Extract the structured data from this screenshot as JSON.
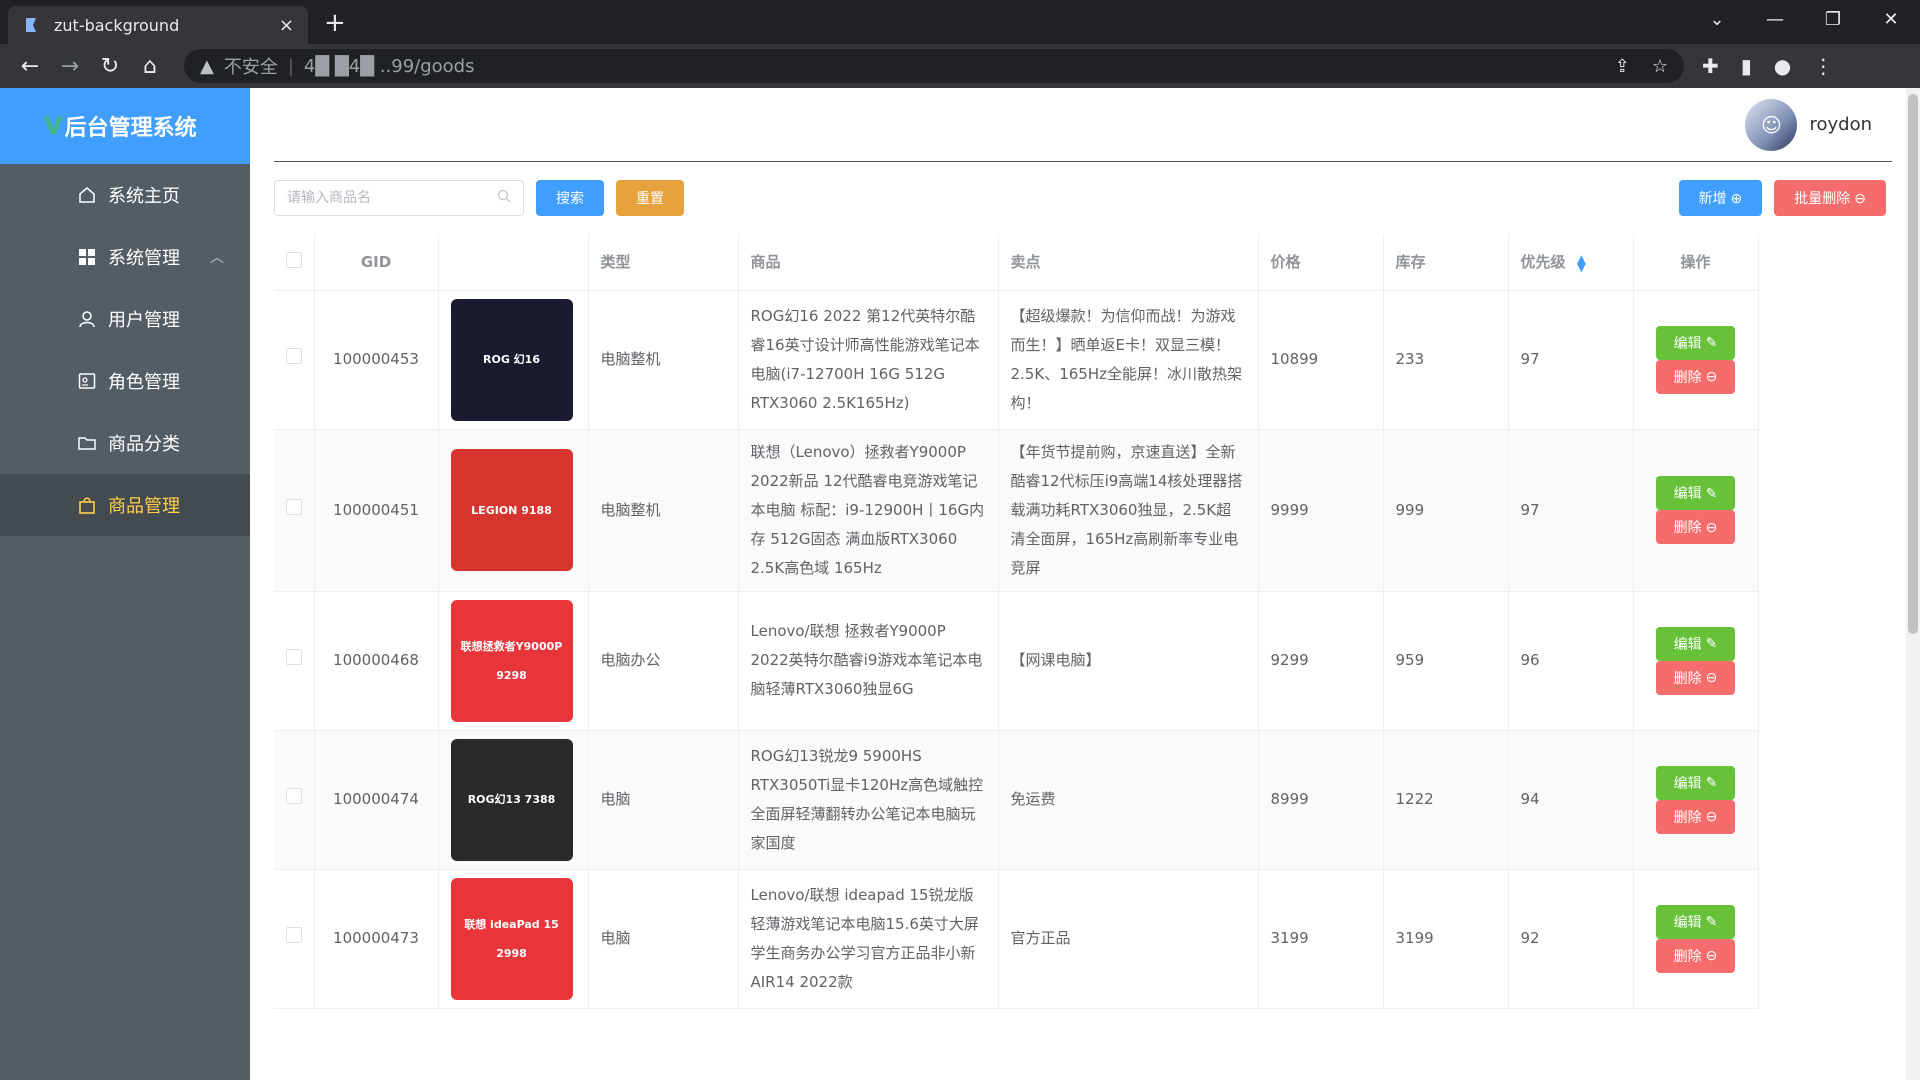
{
  "browser": {
    "tab_title": "zut-background",
    "tab_close": "×",
    "new_tab": "+",
    "security_label": "不安全",
    "url": "4█ █4█ ..99/goods"
  },
  "app": {
    "brand_logo": "V",
    "brand_title": "后台管理系统"
  },
  "sidebar": {
    "items": [
      {
        "label": "系统主页",
        "icon": "home-icon"
      },
      {
        "label": "系统管理",
        "icon": "grid-icon"
      },
      {
        "label": "用户管理",
        "icon": "user-icon"
      },
      {
        "label": "角色管理",
        "icon": "id-card-icon"
      },
      {
        "label": "商品分类",
        "icon": "folder-icon"
      },
      {
        "label": "商品管理",
        "icon": "shopping-bag-icon",
        "active": true
      }
    ]
  },
  "header": {
    "username": "roydon"
  },
  "controls": {
    "search_placeholder": "请输入商品名",
    "search_button": "搜索",
    "reset_button": "重置",
    "add_button": "新增",
    "batch_delete_button": "批量删除"
  },
  "table": {
    "columns": [
      "GID",
      "",
      "类型",
      "商品",
      "卖点",
      "价格",
      "库存",
      "优先级",
      "操作"
    ],
    "edit_label": "编辑",
    "delete_label": "删除",
    "rows": [
      {
        "gid": "100000453",
        "type": "电脑整机",
        "product": "ROG幻16 2022 第12代英特尔酷睿16英寸设计师高性能游戏笔记本电脑(i7-12700H 16G 512G RTX3060 2.5K165Hz)",
        "selling_point": "【超级爆款！为信仰而战！为游戏而生！】晒单返E卡！双显三模！2.5K、165Hz全能屏！冰川散热架构！",
        "price": "10899",
        "stock": "233",
        "priority": "97",
        "thumb_color": "#1b1b2f",
        "thumb_label": "ROG 幻16"
      },
      {
        "gid": "100000451",
        "type": "电脑整机",
        "product": "联想（Lenovo）拯救者Y9000P 2022新品 12代酷睿电竞游戏笔记本电脑 标配：i9-12900H丨16G内存 512G固态 满血版RTX3060 2.5K高色域 165Hz",
        "selling_point": "【年货节提前购，京速直送】全新酷睿12代标压i9高端14核处理器搭载满功耗RTX3060独显，2.5K超清全面屏，165Hz高刷新率专业电竞屏",
        "price": "9999",
        "stock": "999",
        "priority": "97",
        "thumb_color": "#d6342f",
        "thumb_label": "LEGION 9188"
      },
      {
        "gid": "100000468",
        "type": "电脑办公",
        "product": "Lenovo/联想 拯救者Y9000P 2022英特尔酷睿i9游戏本笔记本电脑轻薄RTX3060独显6G",
        "selling_point": "【网课电脑】",
        "price": "9299",
        "stock": "959",
        "priority": "96",
        "thumb_color": "#e8353a",
        "thumb_label": "联想拯救者Y9000P 9298"
      },
      {
        "gid": "100000474",
        "type": "电脑",
        "product": "ROG幻13锐龙9 5900HS RTX3050Ti显卡120Hz高色域触控全面屏轻薄翻转办公笔记本电脑玩家国度",
        "selling_point": "免运费",
        "price": "8999",
        "stock": "1222",
        "priority": "94",
        "thumb_color": "#2a2a2a",
        "thumb_label": "ROG幻13 7388"
      },
      {
        "gid": "100000473",
        "type": "电脑",
        "product": "Lenovo/联想 ideapad 15锐龙版轻薄游戏笔记本电脑15.6英寸大屏学生商务办公学习官方正品非小新AIR14 2022款",
        "selling_point": "官方正品",
        "price": "3199",
        "stock": "3199",
        "priority": "92",
        "thumb_color": "#e8353a",
        "thumb_label": "联想 ideaPad 15 2998"
      }
    ]
  }
}
